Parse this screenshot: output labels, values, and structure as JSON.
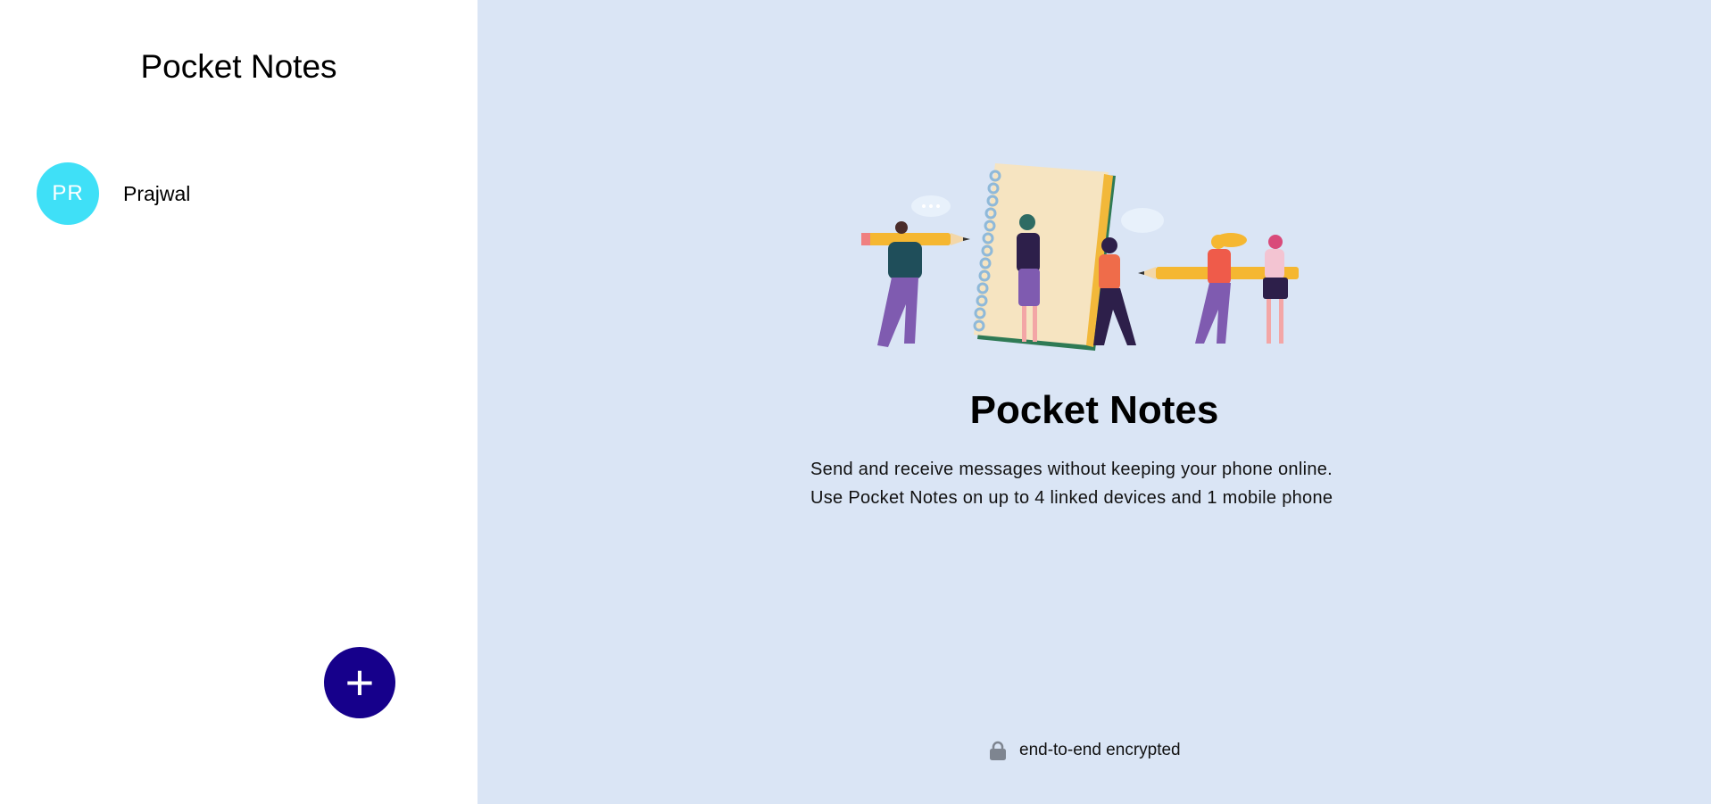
{
  "sidebar": {
    "title": "Pocket Notes",
    "groups": [
      {
        "initials": "PR",
        "name": "Prajwal",
        "color": "#3fe0f7"
      }
    ],
    "add_button": {
      "icon": "plus-icon",
      "label": "+",
      "color": "#16008b"
    }
  },
  "main": {
    "background": "#dae5f5",
    "title": "Pocket Notes",
    "description_line1": "Send and receive messages without keeping your phone online.",
    "description_line2": "Use Pocket Notes on up to 4 linked devices and 1 mobile phone",
    "footer": {
      "icon": "lock-icon",
      "text": "end-to-end encrypted"
    }
  }
}
